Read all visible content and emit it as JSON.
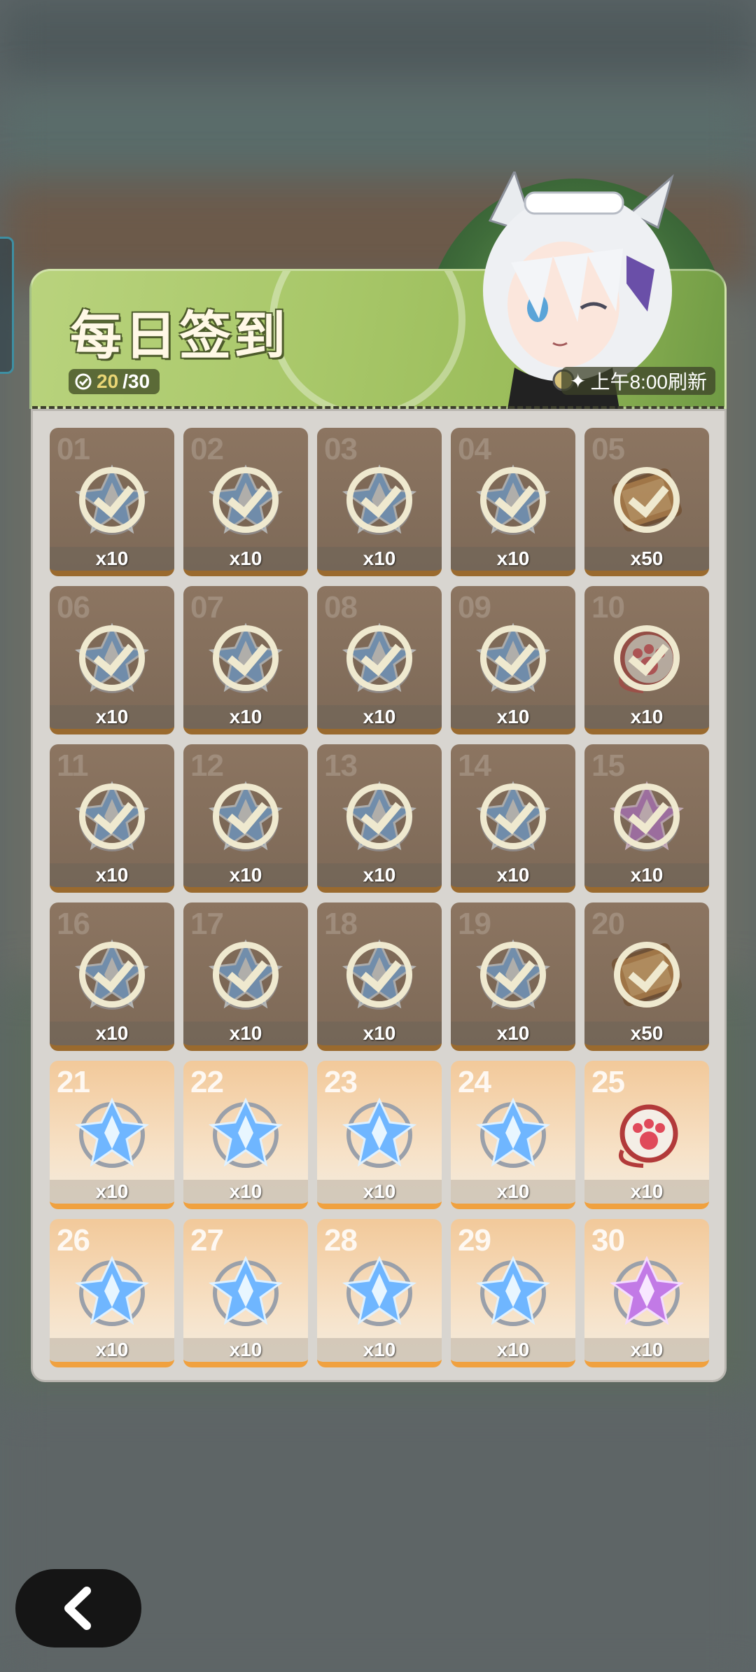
{
  "header": {
    "title": "每日签到",
    "progress_current": "20",
    "progress_total": "/30",
    "refresh_note": "上午8:00刷新"
  },
  "rewards": [
    {
      "day": "01",
      "qty": "x10",
      "item": "blue-crystal",
      "claimed": true
    },
    {
      "day": "02",
      "qty": "x10",
      "item": "blue-crystal",
      "claimed": true
    },
    {
      "day": "03",
      "qty": "x10",
      "item": "blue-crystal",
      "claimed": true
    },
    {
      "day": "04",
      "qty": "x10",
      "item": "blue-crystal",
      "claimed": true
    },
    {
      "day": "05",
      "qty": "x50",
      "item": "gold-ticket",
      "claimed": true
    },
    {
      "day": "06",
      "qty": "x10",
      "item": "blue-crystal",
      "claimed": true
    },
    {
      "day": "07",
      "qty": "x10",
      "item": "blue-crystal",
      "claimed": true
    },
    {
      "day": "08",
      "qty": "x10",
      "item": "blue-crystal",
      "claimed": true
    },
    {
      "day": "09",
      "qty": "x10",
      "item": "blue-crystal",
      "claimed": true
    },
    {
      "day": "10",
      "qty": "x10",
      "item": "paw-charm",
      "claimed": true
    },
    {
      "day": "11",
      "qty": "x10",
      "item": "blue-crystal",
      "claimed": true
    },
    {
      "day": "12",
      "qty": "x10",
      "item": "blue-crystal",
      "claimed": true
    },
    {
      "day": "13",
      "qty": "x10",
      "item": "blue-crystal",
      "claimed": true
    },
    {
      "day": "14",
      "qty": "x10",
      "item": "blue-crystal",
      "claimed": true
    },
    {
      "day": "15",
      "qty": "x10",
      "item": "purple-crystal",
      "claimed": true
    },
    {
      "day": "16",
      "qty": "x10",
      "item": "blue-crystal",
      "claimed": true
    },
    {
      "day": "17",
      "qty": "x10",
      "item": "blue-crystal",
      "claimed": true
    },
    {
      "day": "18",
      "qty": "x10",
      "item": "blue-crystal",
      "claimed": true
    },
    {
      "day": "19",
      "qty": "x10",
      "item": "blue-crystal",
      "claimed": true
    },
    {
      "day": "20",
      "qty": "x50",
      "item": "gold-ticket",
      "claimed": true
    },
    {
      "day": "21",
      "qty": "x10",
      "item": "blue-crystal",
      "claimed": false
    },
    {
      "day": "22",
      "qty": "x10",
      "item": "blue-crystal",
      "claimed": false
    },
    {
      "day": "23",
      "qty": "x10",
      "item": "blue-crystal",
      "claimed": false
    },
    {
      "day": "24",
      "qty": "x10",
      "item": "blue-crystal",
      "claimed": false
    },
    {
      "day": "25",
      "qty": "x10",
      "item": "paw-charm",
      "claimed": false
    },
    {
      "day": "26",
      "qty": "x10",
      "item": "blue-crystal",
      "claimed": false
    },
    {
      "day": "27",
      "qty": "x10",
      "item": "blue-crystal",
      "claimed": false
    },
    {
      "day": "28",
      "qty": "x10",
      "item": "blue-crystal",
      "claimed": false
    },
    {
      "day": "29",
      "qty": "x10",
      "item": "blue-crystal",
      "claimed": false
    },
    {
      "day": "30",
      "qty": "x10",
      "item": "purple-crystal",
      "claimed": false
    }
  ],
  "colors": {
    "header_green": "#a9c86a",
    "claimed_cell": "#8c7561",
    "pending_cell": "#f2c99a",
    "accent_orange": "#f0a13f"
  },
  "icons": {
    "back": "chevron-left-icon",
    "claimed": "check-circle-icon",
    "progress": "check-circle-icon",
    "refresh": "sparkle-icon"
  }
}
